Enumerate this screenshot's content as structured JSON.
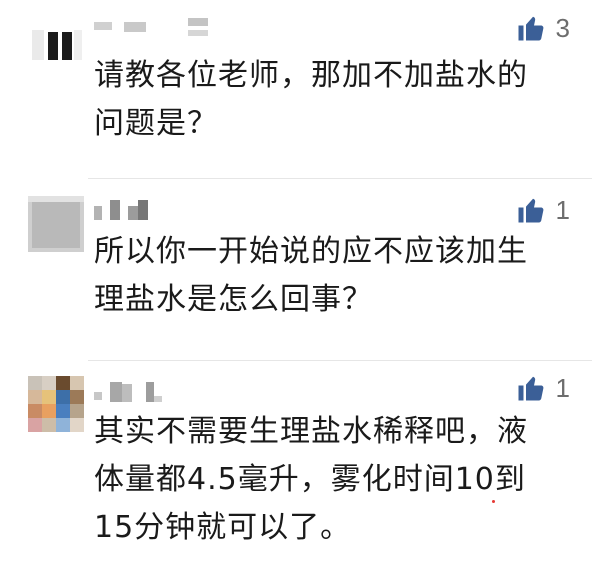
{
  "comments": [
    {
      "text": "请教各位老师，那加不加盐水的\n问题是？",
      "likes": "3"
    },
    {
      "text": "所以你一开始说的应不应该加生\n理盐水是怎么回事？",
      "likes": "1"
    },
    {
      "text": "其实不需要生理盐水稀释吧，液\n体量都4.5毫升，雾化时间10到\n15分钟就可以了。",
      "likes": "1"
    }
  ],
  "colors": {
    "like_icon": "#3b5f97",
    "like_count": "#6d6d6d",
    "text": "#1a1a1a",
    "divider": "#e6e6e6"
  },
  "icons": {
    "like": "thumbs-up-icon"
  }
}
